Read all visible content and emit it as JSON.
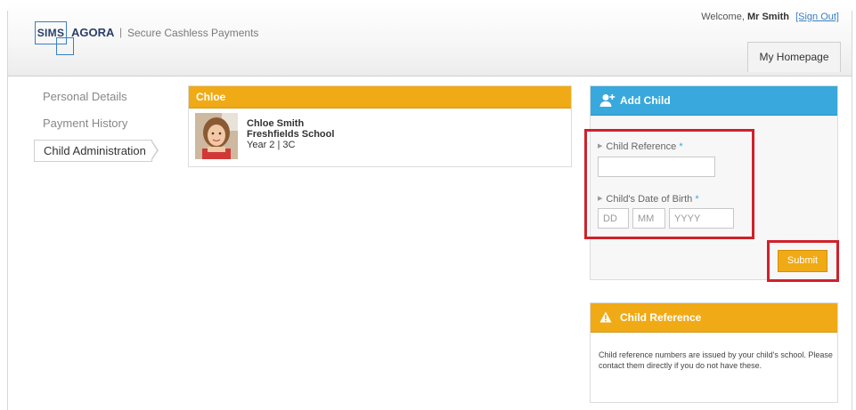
{
  "header": {
    "logo_sims": "SIMS",
    "logo_agora": "AGORA",
    "logo_separator": "|",
    "tagline": "Secure Cashless Payments",
    "welcome_prefix": "Welcome,",
    "user_name": "Mr Smith",
    "sign_out_label": "[Sign Out]",
    "home_tab_label": "My Homepage"
  },
  "nav": {
    "items": [
      {
        "label": "Personal Details"
      },
      {
        "label": "Payment History"
      },
      {
        "label": "Child Administration"
      }
    ]
  },
  "child_card": {
    "header": "Chloe",
    "name": "Chloe Smith",
    "school": "Freshfields School",
    "year_class": "Year 2 | 3C"
  },
  "add_child": {
    "title": "Add Child",
    "child_reference_label": "Child Reference",
    "dob_label": "Child's Date of Birth",
    "required_marker": "*",
    "child_reference_value": "",
    "dob_day_placeholder": "DD",
    "dob_month_placeholder": "MM",
    "dob_year_placeholder": "YYYY",
    "submit_label": "Submit"
  },
  "child_reference_info": {
    "title": "Child Reference",
    "text": "Child reference numbers are issued by your child's school. Please contact them directly if you do not have these."
  },
  "colors": {
    "accent_orange": "#f0aa16",
    "accent_blue": "#39a8dc",
    "highlight_red": "#d0202a"
  }
}
